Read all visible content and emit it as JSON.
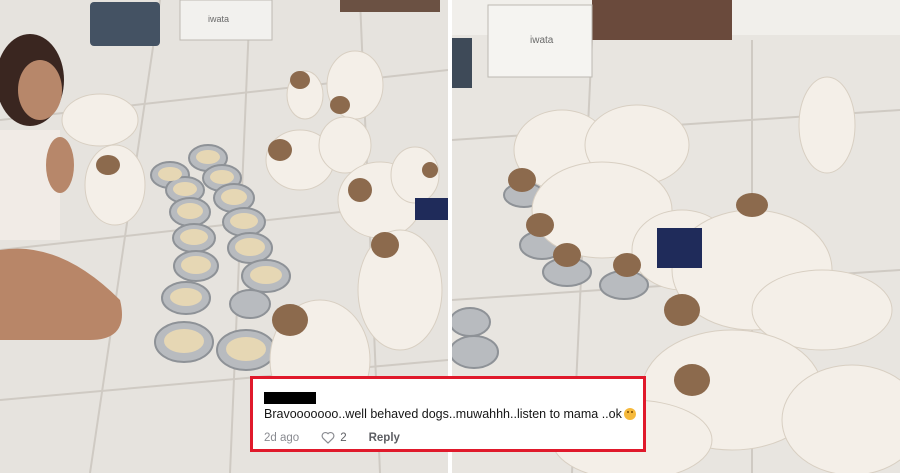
{
  "photos": {
    "left": {
      "icon": "dogs-feeding-photo"
    },
    "right": {
      "icon": "dogs-eating-photo"
    },
    "appliance_label": "iwata"
  },
  "comment": {
    "text": "Bravooooooo..well behaved dogs..muwahhh..listen to mama ..ok",
    "emoji_icon": "grinning-face-icon",
    "timestamp": "2d ago",
    "likes": "2",
    "reply_label": "Reply",
    "highlight_color": "#e0192b"
  }
}
